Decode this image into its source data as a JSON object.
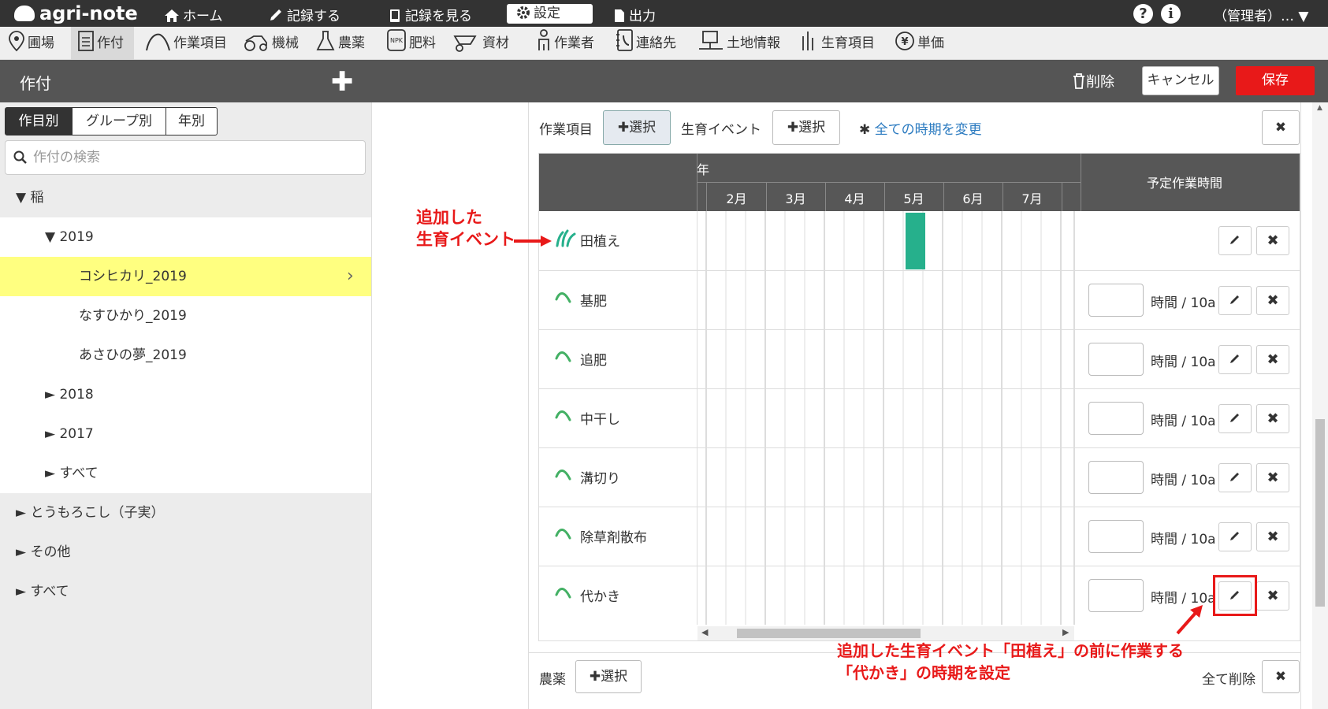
{
  "topbar": {
    "logo": "agri-note",
    "nav": [
      {
        "label": "ホーム",
        "icon": "home-icon"
      },
      {
        "label": "記録する",
        "icon": "pencil-icon"
      },
      {
        "label": "記録を見る",
        "icon": "book-icon"
      },
      {
        "label": "設定",
        "icon": "gear-icon"
      },
      {
        "label": "出力",
        "icon": "document-icon"
      }
    ],
    "help": "?",
    "info": "i",
    "user": "（管理者）…"
  },
  "menu": [
    {
      "label": "圃場",
      "icon": "map-pin-icon"
    },
    {
      "label": "作付",
      "icon": "list-icon"
    },
    {
      "label": "作業項目",
      "icon": "sprout-curve-icon"
    },
    {
      "label": "機械",
      "icon": "tractor-icon"
    },
    {
      "label": "農薬",
      "icon": "flask-icon"
    },
    {
      "label": "肥料",
      "icon": "npk-bag-icon"
    },
    {
      "label": "資材",
      "icon": "wheelbarrow-icon"
    },
    {
      "label": "作業者",
      "icon": "person-icon"
    },
    {
      "label": "連絡先",
      "icon": "phone-book-icon"
    },
    {
      "label": "土地情報",
      "icon": "land-icon"
    },
    {
      "label": "生育項目",
      "icon": "growth-icon"
    },
    {
      "label": "単価",
      "icon": "yen-icon"
    }
  ],
  "titlebar": {
    "title": "作付",
    "add": "✚",
    "delete": "削除",
    "cancel": "キャンセル",
    "save": "保存"
  },
  "sidebar": {
    "tabs": [
      "作目別",
      "グループ別",
      "年別"
    ],
    "search_placeholder": "作付の検索",
    "tree": [
      {
        "label": "▼ 稲"
      },
      {
        "label": "▼ 2019"
      },
      {
        "label": "コシヒカリ_2019"
      },
      {
        "label": "なすひかり_2019"
      },
      {
        "label": "あさひの夢_2019"
      },
      {
        "label": "► 2018"
      },
      {
        "label": "► 2017"
      },
      {
        "label": "► すべて"
      },
      {
        "label": "► とうもろこし（子実）"
      },
      {
        "label": "► その他"
      },
      {
        "label": "► すべて"
      }
    ]
  },
  "main": {
    "task_label": "作業項目",
    "task_select": "選択",
    "event_label": "生育イベント",
    "event_select": "選択",
    "change_all": "全ての時期を変更",
    "close": "✖",
    "year_header": "年",
    "months": [
      "2月",
      "3月",
      "4月",
      "5月",
      "6月",
      "7月"
    ],
    "hours_header": "予定作業時間",
    "rows": [
      {
        "name": "田植え",
        "type": "event",
        "bar_month": "5月"
      },
      {
        "name": "基肥",
        "type": "task",
        "unit": "時間 / 10a"
      },
      {
        "name": "追肥",
        "type": "task",
        "unit": "時間 / 10a"
      },
      {
        "name": "中干し",
        "type": "task",
        "unit": "時間 / 10a"
      },
      {
        "name": "溝切り",
        "type": "task",
        "unit": "時間 / 10a"
      },
      {
        "name": "除草剤散布",
        "type": "task",
        "unit": "時間 / 10a"
      },
      {
        "name": "代かき",
        "type": "task",
        "unit": "時間 / 10a"
      }
    ],
    "pesticide_label": "農薬",
    "pesticide_select": "選択",
    "delete_all": "全て削除",
    "event_color": "#26b08c"
  },
  "annotations": {
    "added_event_line1": "追加した",
    "added_event_line2": "生育イベント",
    "bottom_line1": "追加した生育イベント「田植え」の前に作業する",
    "bottom_line2": "「代かき」の時期を設定"
  }
}
